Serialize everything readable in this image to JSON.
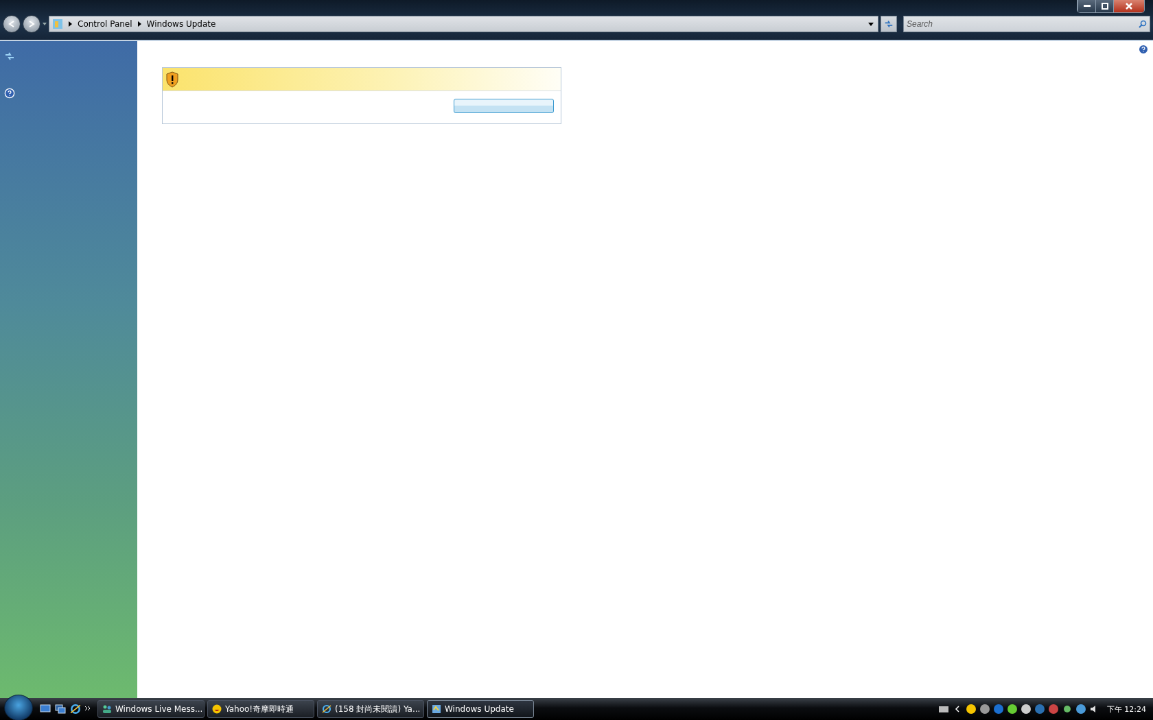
{
  "address_bar": {
    "breadcrumbs": [
      "Control Panel",
      "Windows Update"
    ]
  },
  "search": {
    "placeholder": "Search"
  },
  "taskbar": {
    "buttons": [
      {
        "label": "Windows Live Mess...",
        "selected": false
      },
      {
        "label": "Yahoo!奇摩即時通",
        "selected": false
      },
      {
        "label": "(158 封尚未閱讀) Ya...",
        "selected": false
      },
      {
        "label": "Windows Update",
        "selected": true
      }
    ],
    "clock": "下午 12:24"
  }
}
